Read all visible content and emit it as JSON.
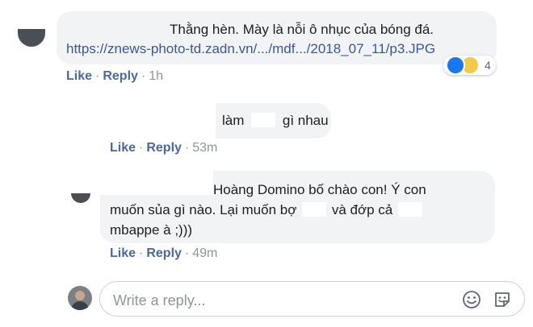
{
  "comments": [
    {
      "lines": [
        "Thằng hèn. Mày là nỗi ô nhục của bóng đá."
      ],
      "link": "https://znews-photo-td.zadn.vn/.../mdf.../2018_07_11/p3.JPG",
      "like_label": "Like",
      "reply_label": "Reply",
      "time": "1h",
      "reactions": {
        "types": [
          "like",
          "haha"
        ],
        "count": "4"
      }
    },
    {
      "line_before": "làm",
      "line_after": "gì nhau",
      "like_label": "Like",
      "reply_label": "Reply",
      "time": "53m"
    },
    {
      "line1": "Hoàng Domino bố chào con! Ý con",
      "line2_before": "muốn sủa gì nào. Lại muốn bợ",
      "line2_mid": "và đớp cả",
      "line3": "mbappe à ;)))",
      "like_label": "Like",
      "reply_label": "Reply",
      "time": "49m"
    }
  ],
  "reply_box": {
    "placeholder": "Write a reply...",
    "icons": [
      "smiley-icon",
      "sticker-icon"
    ]
  },
  "separator": "·"
}
